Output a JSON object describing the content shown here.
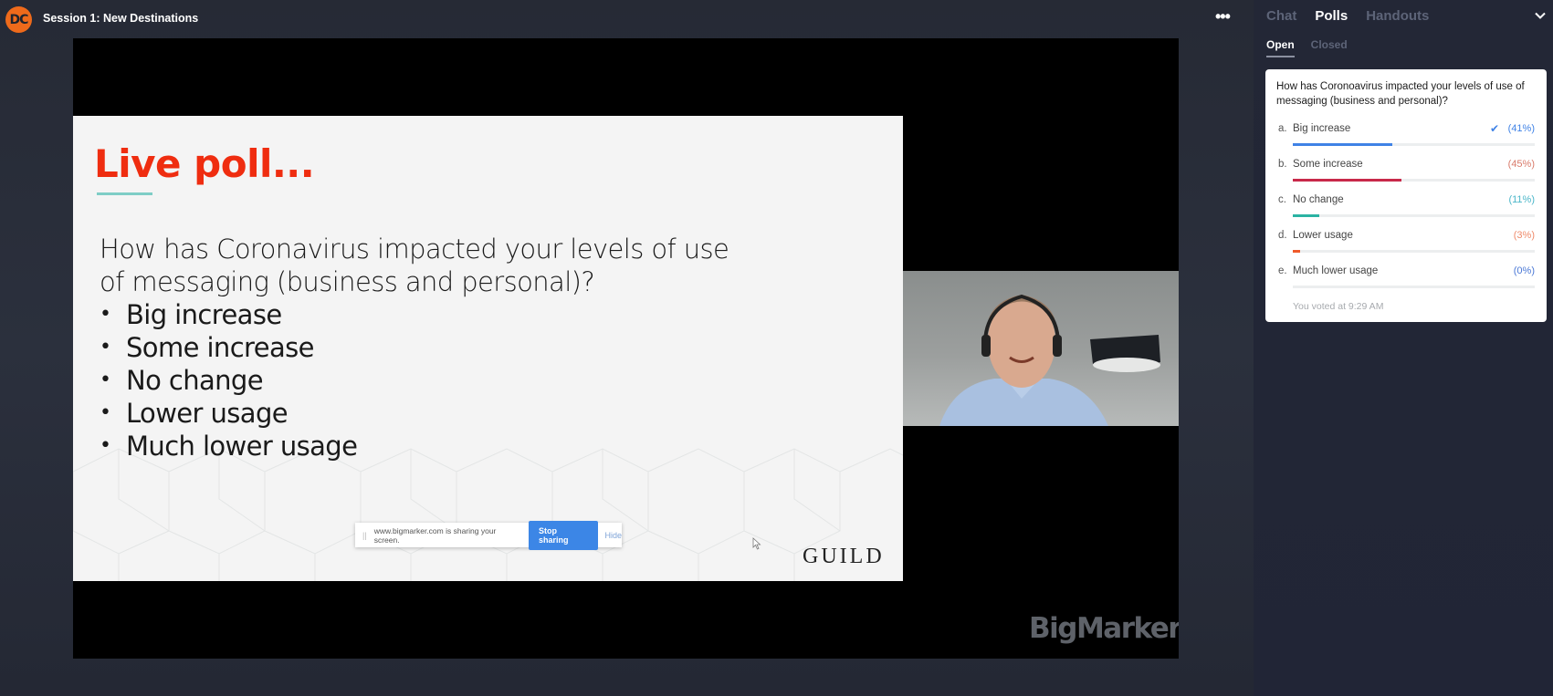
{
  "header": {
    "logo_text": "DC",
    "session_title": "Session 1: New Destinations",
    "more_icon": "ellipsis-icon"
  },
  "slide": {
    "title": "Live poll...",
    "question": "How has Coronavirus impacted your levels of use of messaging (business and personal)?",
    "options": [
      "Big increase",
      "Some increase",
      "No change",
      "Lower usage",
      "Much lower usage"
    ],
    "brand": "GUILD",
    "share_bar": {
      "message": "www.bigmarker.com is sharing your screen.",
      "stop_label": "Stop sharing",
      "hide_label": "Hide"
    }
  },
  "watermark": "BigMarker",
  "sidebar": {
    "tabs": [
      {
        "label": "Chat",
        "active": false
      },
      {
        "label": "Polls",
        "active": true
      },
      {
        "label": "Handouts",
        "active": false
      }
    ],
    "subtabs": [
      {
        "label": "Open",
        "active": true
      },
      {
        "label": "Closed",
        "active": false
      }
    ],
    "poll": {
      "question": "How has Coronoavirus impacted your levels of use of messaging (business and personal)?",
      "options": [
        {
          "letter": "a.",
          "label": "Big increase",
          "pct_text": "(41%)",
          "percent": 41,
          "color": "#3f82e6",
          "pct_color": "#3f82e6",
          "voted": true
        },
        {
          "letter": "b.",
          "label": "Some increase",
          "pct_text": "(45%)",
          "percent": 45,
          "color": "#c8294a",
          "pct_color": "#d97a6a",
          "voted": false
        },
        {
          "letter": "c.",
          "label": "No change",
          "pct_text": "(11%)",
          "percent": 11,
          "color": "#2bb3a3",
          "pct_color": "#4ab6c9",
          "voted": false
        },
        {
          "letter": "d.",
          "label": "Lower usage",
          "pct_text": "(3%)",
          "percent": 3,
          "color": "#ef5a2a",
          "pct_color": "#ef8a6a",
          "voted": false
        },
        {
          "letter": "e.",
          "label": "Much lower usage",
          "pct_text": "(0%)",
          "percent": 0,
          "color": "#3f6fd6",
          "pct_color": "#4a78d6",
          "voted": false
        }
      ],
      "voted_text": "You voted at 9:29 AM"
    }
  }
}
